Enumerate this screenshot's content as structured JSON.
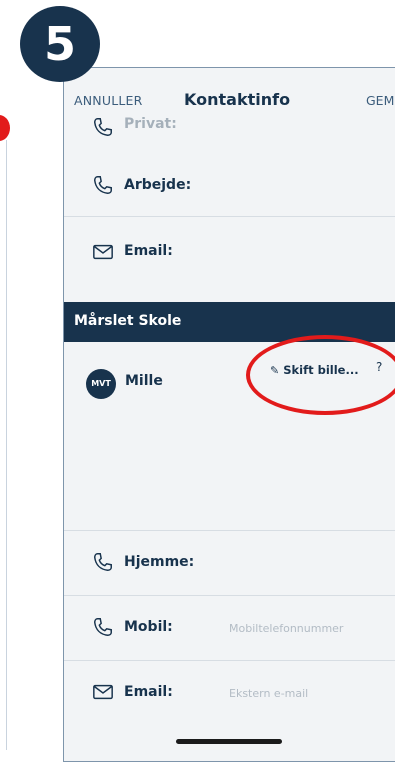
{
  "step_badge": "5",
  "navbar": {
    "cancel": "ANNULLER",
    "title": "Kontaktinfo",
    "save": "GEM"
  },
  "top_rows": [
    {
      "label": "Privat:",
      "icon": "phone-icon"
    },
    {
      "label": "Arbejde:",
      "icon": "phone-icon"
    },
    {
      "label": "Email:",
      "icon": "envelope-icon"
    }
  ],
  "section": {
    "title": "Mårslet Skole"
  },
  "child": {
    "initials": "MVT",
    "name": "Mille",
    "change_photo": "Skift bille...",
    "help": "?"
  },
  "bottom_rows": [
    {
      "label": "Hjemme:",
      "placeholder": "",
      "icon": "phone-icon"
    },
    {
      "label": "Mobil:",
      "placeholder": "Mobiltelefonnummer",
      "icon": "phone-icon"
    },
    {
      "label": "Email:",
      "placeholder": "Ekstern e-mail",
      "icon": "envelope-icon"
    }
  ],
  "colors": {
    "navy": "#18334d",
    "highlight_red": "#e21b1b",
    "background": "#f2f4f6"
  }
}
